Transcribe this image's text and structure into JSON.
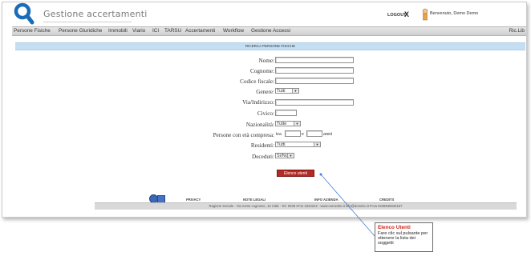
{
  "header": {
    "app_title": "Gestione accertamenti",
    "logout_label": "LOGOUT",
    "logout_x": "X",
    "welcome_text": "Benvenuto, Demo Demo"
  },
  "menu": {
    "items": [
      "Persone Fisiche",
      "Persone Giuridiche",
      "Immobili",
      "Viario",
      "ICI",
      "TARSU",
      "Accertamenti",
      "Workflow",
      "Gestione Accessi"
    ],
    "right_label": "Ric.Lib"
  },
  "form": {
    "section_title": "RICERCA PERSONE FISICHE",
    "labels": {
      "nome": "Nome:",
      "cognome": "Cognome:",
      "codice_fiscale": "Codice fiscale:",
      "genere": "Genere:",
      "via": "Via/Indirizzo:",
      "civico": "Civico:",
      "nazionalita": "Nazionalità:",
      "eta": "Persone con età compresa:",
      "residenti": "Residenti:",
      "deceduti": "Deceduti:"
    },
    "values": {
      "genere": "Tutti",
      "nazionalita": "Tutte",
      "residenti": "Tutti",
      "deceduti": "Sì/No"
    },
    "eta_parts": {
      "tra": "tra",
      "e": "e",
      "anni": "anni"
    },
    "button_label": "Elenco utenti"
  },
  "footer": {
    "links": [
      "PRIVACY",
      "NOTE LEGALI",
      "INFO AZIENDA",
      "CREDITS"
    ],
    "company_line": "Ragione Sociale - Via nome cognome, 10 Città - Tel. 0039 0711 2222222 - www.nomesito.it info@dominio.it P.Iva 0239845632157"
  },
  "callout": {
    "title": "Elenco Utenti",
    "text": "Fare clic sul pulsante per ottenere la lista dei soggetti"
  },
  "colors": {
    "section_bar": "#c4dff4",
    "button": "#b52a24",
    "callout_title": "#d0261f",
    "logo": "#1a6bb8"
  }
}
